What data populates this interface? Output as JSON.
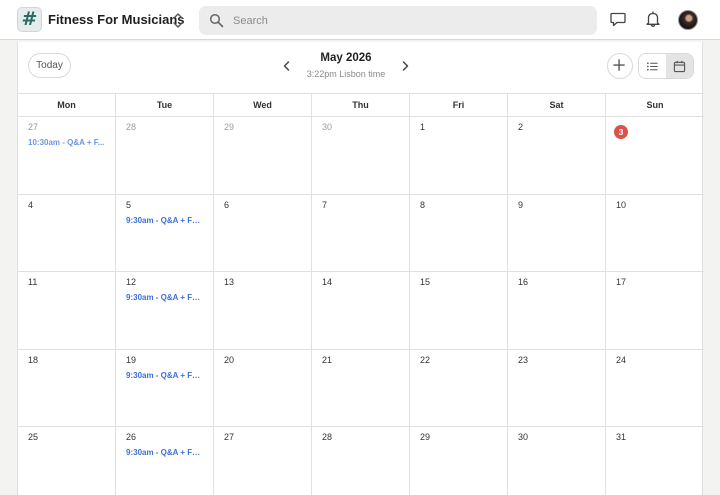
{
  "header": {
    "logo_glyph": "#",
    "app_name": "Fitness For Musicians",
    "search_placeholder": "Search"
  },
  "toolbar": {
    "today_label": "Today",
    "month_title": "May 2026",
    "timezone": "3:22pm Lisbon time"
  },
  "weekdays": [
    "Mon",
    "Tue",
    "Wed",
    "Thu",
    "Fri",
    "Sat",
    "Sun"
  ],
  "weeks": [
    [
      {
        "day": "27",
        "other_month": true,
        "event": "10:30am - Q&A + F..."
      },
      {
        "day": "28",
        "other_month": true
      },
      {
        "day": "29",
        "other_month": true
      },
      {
        "day": "30",
        "other_month": true
      },
      {
        "day": "1"
      },
      {
        "day": "2"
      },
      {
        "day": "3",
        "today": true
      }
    ],
    [
      {
        "day": "4"
      },
      {
        "day": "5",
        "event": "9:30am - Q&A + Fo..."
      },
      {
        "day": "6"
      },
      {
        "day": "7"
      },
      {
        "day": "8"
      },
      {
        "day": "9"
      },
      {
        "day": "10"
      }
    ],
    [
      {
        "day": "11"
      },
      {
        "day": "12",
        "event": "9:30am - Q&A + Fo..."
      },
      {
        "day": "13"
      },
      {
        "day": "14"
      },
      {
        "day": "15"
      },
      {
        "day": "16"
      },
      {
        "day": "17"
      }
    ],
    [
      {
        "day": "18"
      },
      {
        "day": "19",
        "event": "9:30am - Q&A + Fo..."
      },
      {
        "day": "20"
      },
      {
        "day": "21"
      },
      {
        "day": "22"
      },
      {
        "day": "23"
      },
      {
        "day": "24"
      }
    ],
    [
      {
        "day": "25"
      },
      {
        "day": "26",
        "event": "9:30am - Q&A + Fo..."
      },
      {
        "day": "27"
      },
      {
        "day": "28"
      },
      {
        "day": "29"
      },
      {
        "day": "30"
      },
      {
        "day": "31"
      }
    ]
  ],
  "colors": {
    "accent": "#3d6fd9",
    "today_badge": "#d9534a"
  },
  "icons": {
    "switcher": "chevron-up-down-icon",
    "search": "search-icon",
    "messages": "chat-bubble-icon",
    "notifications": "bell-icon",
    "prev": "chevron-left-icon",
    "next": "chevron-right-icon",
    "add": "plus-icon",
    "list_view": "list-icon",
    "calendar_view": "calendar-icon"
  }
}
